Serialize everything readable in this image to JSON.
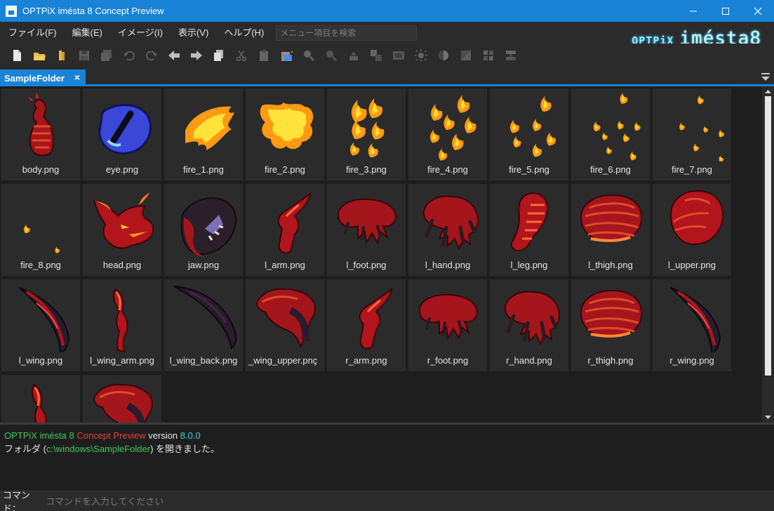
{
  "window": {
    "title": "OPTPiX iméstа 8 Concept Preview",
    "buttons": {
      "minimize": "minimize-icon",
      "maximize": "maximize-icon",
      "close": "close-icon"
    }
  },
  "menu": {
    "items": [
      "ファイル(F)",
      "編集(E)",
      "イメージ(I)",
      "表示(V)",
      "ヘルプ(H)"
    ],
    "search_placeholder": "メニュー項目を検索"
  },
  "logo": {
    "brand": "OPTPiX",
    "product": "iméstа8"
  },
  "toolbar": {
    "icons": [
      "new-file-icon",
      "open-folder-icon",
      "folder-icon",
      "save-icon",
      "save-all-icon",
      "undo-icon",
      "redo-icon",
      "back-icon",
      "forward-icon",
      "copy-icon",
      "cut-icon",
      "paste-icon",
      "paste-new-icon",
      "zoom-in-icon",
      "zoom-out-icon",
      "filter-icon",
      "layers-icon",
      "resize-icon",
      "brightness-icon",
      "contrast-icon",
      "color-icon",
      "flip-horizontal-icon",
      "flip-vertical-icon"
    ]
  },
  "tabs": [
    {
      "label": "SampleFolder",
      "close": "×"
    }
  ],
  "files": [
    {
      "name": "body.png",
      "kind": "body"
    },
    {
      "name": "eye.png",
      "kind": "eye"
    },
    {
      "name": "fire_1.png",
      "kind": "fire1"
    },
    {
      "name": "fire_2.png",
      "kind": "fire2"
    },
    {
      "name": "fire_3.png",
      "kind": "fire3"
    },
    {
      "name": "fire_4.png",
      "kind": "fire4"
    },
    {
      "name": "fire_5.png",
      "kind": "fire5"
    },
    {
      "name": "fire_6.png",
      "kind": "fire6"
    },
    {
      "name": "fire_7.png",
      "kind": "fire7"
    },
    {
      "name": "fire_8.png",
      "kind": "fire8"
    },
    {
      "name": "head.png",
      "kind": "head"
    },
    {
      "name": "jaw.png",
      "kind": "jaw"
    },
    {
      "name": "l_arm.png",
      "kind": "arm"
    },
    {
      "name": "l_foot.png",
      "kind": "foot"
    },
    {
      "name": "l_hand.png",
      "kind": "hand"
    },
    {
      "name": "l_leg.png",
      "kind": "leg"
    },
    {
      "name": "l_thigh.png",
      "kind": "thigh"
    },
    {
      "name": "l_upper.png",
      "kind": "upper"
    },
    {
      "name": "l_wing.png",
      "kind": "wing"
    },
    {
      "name": "l_wing_arm.png",
      "kind": "wingarm"
    },
    {
      "name": "l_wing_back.png",
      "kind": "wingback"
    },
    {
      "name": "l_wing_upper.png",
      "display": "_wing_upper.pnç",
      "kind": "wingupper"
    },
    {
      "name": "r_arm.png",
      "kind": "arm"
    },
    {
      "name": "r_foot.png",
      "kind": "foot"
    },
    {
      "name": "r_hand.png",
      "kind": "hand"
    },
    {
      "name": "r_thigh.png",
      "kind": "thigh"
    },
    {
      "name": "r_wing.png",
      "kind": "wing"
    },
    {
      "name": "",
      "kind": "wingarm"
    },
    {
      "name": "",
      "kind": "wingupper"
    }
  ],
  "log": {
    "line1": {
      "product": "OPTPiX iméstа 8",
      "edition": "Concept Preview",
      "version_label": "version",
      "version": "8.0.0"
    },
    "line2": {
      "prefix": "フォルダ (",
      "path": "c:\\windows\\SampleFolder",
      "suffix": ") を開きました。"
    }
  },
  "command": {
    "label": "コマンド：",
    "placeholder": "コマンドを入力してください"
  },
  "colors": {
    "accent": "#1883d7",
    "fire": "#ffd21a",
    "dragon_red": "#b3151d",
    "dark_wing": "#2a1c2c"
  }
}
